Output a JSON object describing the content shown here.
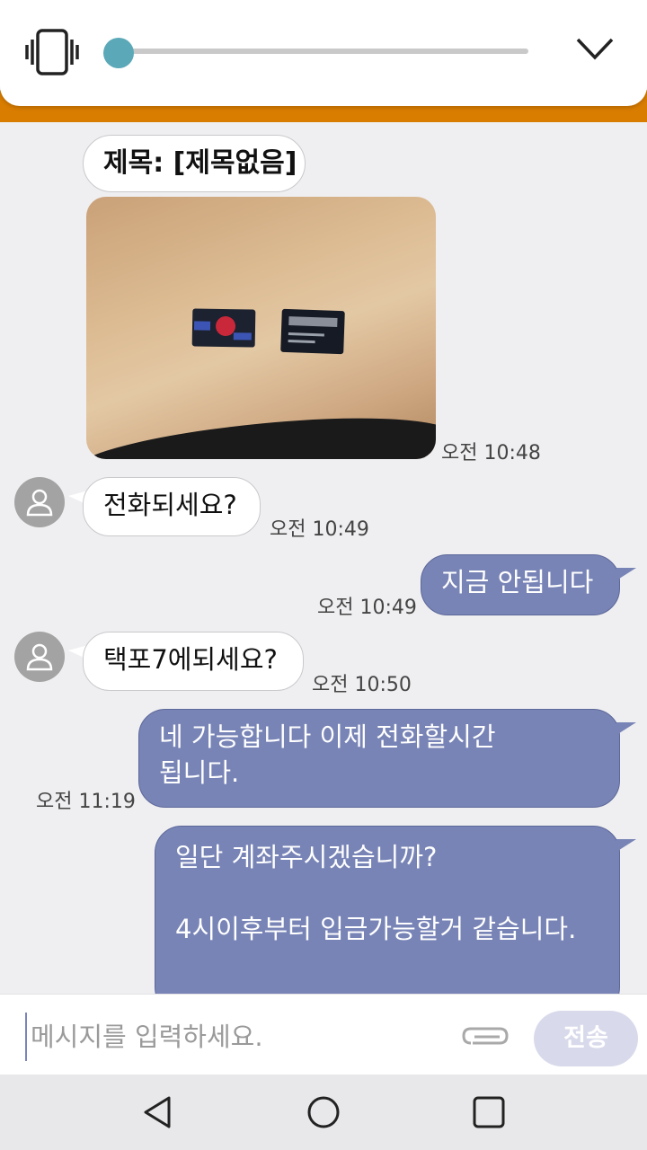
{
  "volume_panel": {
    "mode_icon": "vibrate-icon",
    "level": 0,
    "accent": "#5aa8b8"
  },
  "chat": {
    "subject": "제목: [제목없음]",
    "photo_time": "오전 10:48",
    "messages": [
      {
        "dir": "in",
        "text": "전화되세요?",
        "time": "오전 10:49"
      },
      {
        "dir": "out",
        "text": "지금 안됩니다",
        "time": "오전 10:49"
      },
      {
        "dir": "in",
        "text": "택포7에되세요?",
        "time": "오전 10:50"
      },
      {
        "dir": "out",
        "lines": [
          "네 가능합니다 이제 전화할시간",
          "됩니다."
        ],
        "time": "오전 11:19"
      },
      {
        "dir": "out",
        "lines": [
          "일단 계좌주시겠습니까?",
          "",
          "4시이후부터 입금가능할거 같습니다."
        ],
        "time": ""
      }
    ]
  },
  "input": {
    "placeholder": "메시지를 입력하세요.",
    "value": "",
    "send_label": "전송"
  },
  "colors": {
    "outgoing_bubble": "#7884b6",
    "incoming_bubble": "#ffffff",
    "background": "#efeff1",
    "orange_strip": "#d97d00"
  }
}
